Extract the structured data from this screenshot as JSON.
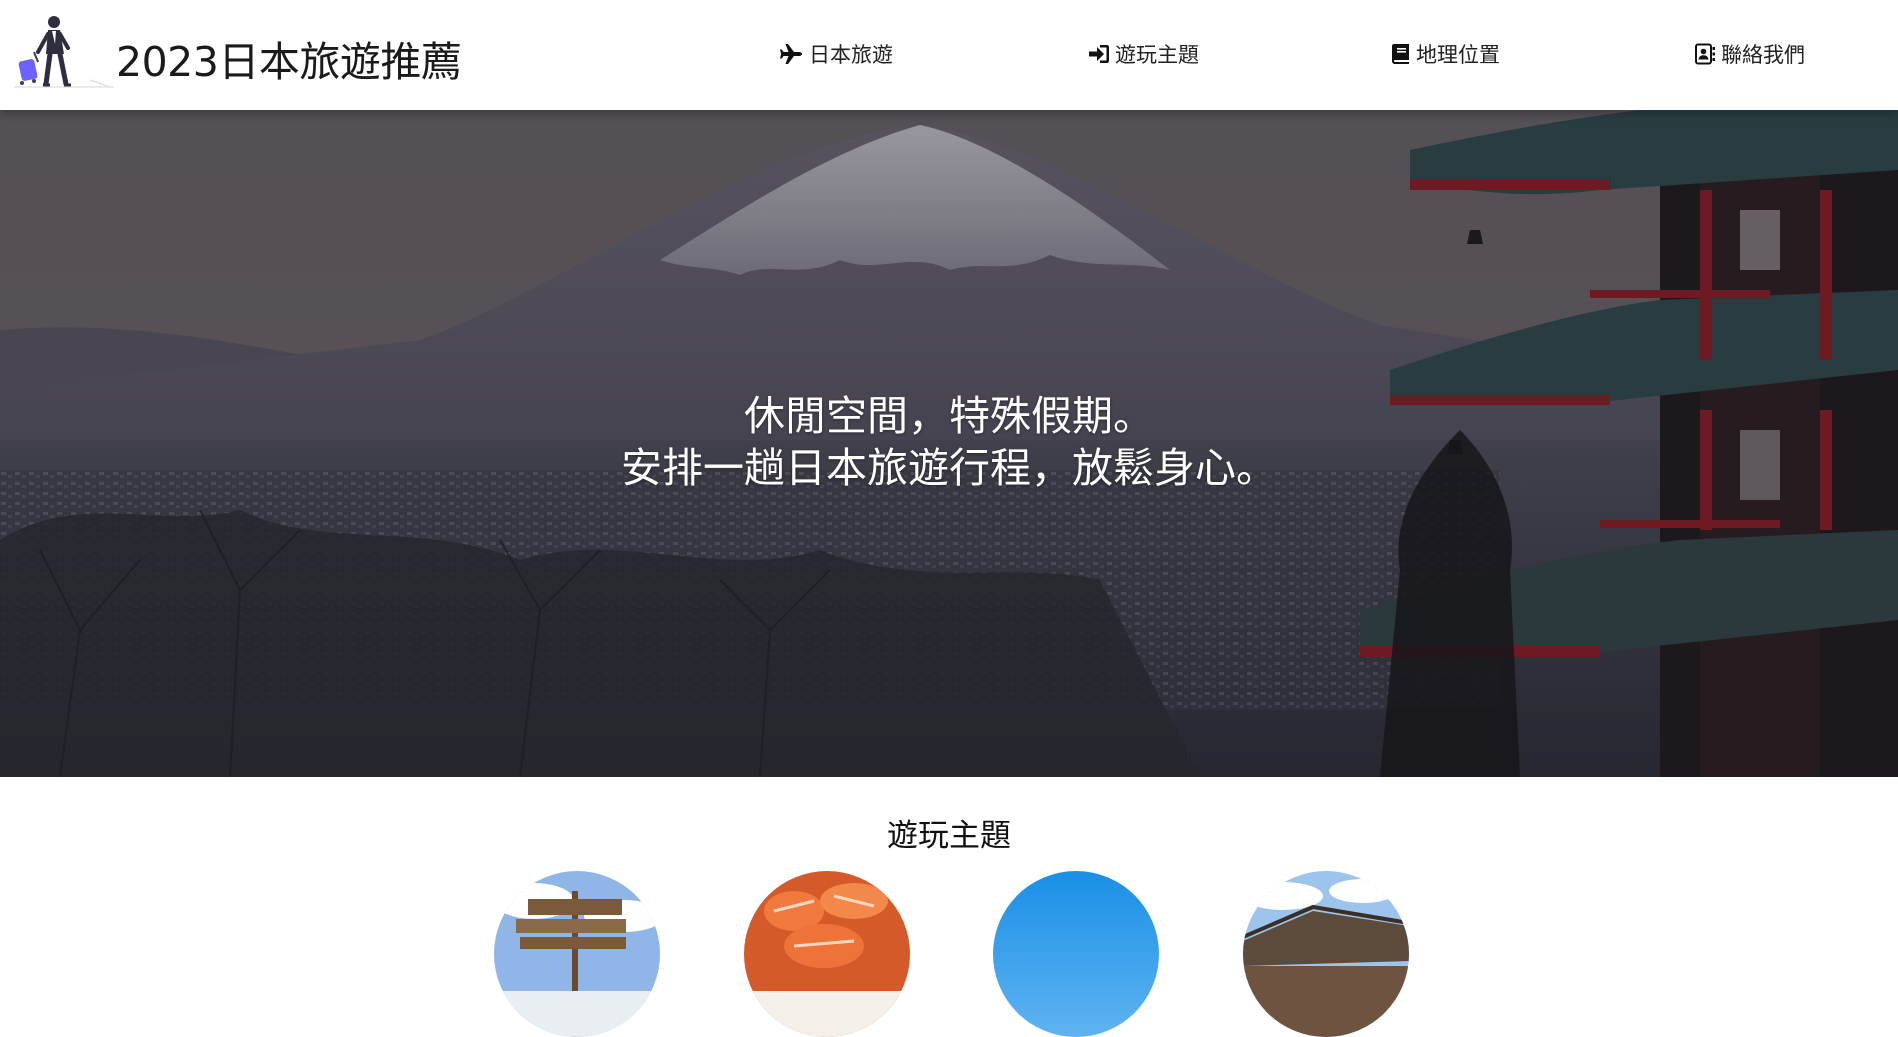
{
  "header": {
    "site_title": "2023日本旅遊推薦",
    "logo_icon": "traveler-with-suitcase-icon"
  },
  "nav": [
    {
      "label": "日本旅遊",
      "icon": "plane-icon"
    },
    {
      "label": "遊玩主題",
      "icon": "sign-in-icon"
    },
    {
      "label": "地理位置",
      "icon": "book-icon"
    },
    {
      "label": "聯絡我們",
      "icon": "address-book-icon"
    }
  ],
  "hero": {
    "line1": "休閒空間，特殊假期。",
    "line2": "安排一趟日本旅遊行程，放鬆身心。"
  },
  "themes": {
    "title": "遊玩主題",
    "items": [
      {
        "image": "sign-board-snow-scene"
      },
      {
        "image": "salmon-sushi-bowl"
      },
      {
        "image": "blue-sky"
      },
      {
        "image": "temple-roof"
      }
    ]
  },
  "colors": {
    "hero_overlay": "#2a2a32",
    "pagoda_red": "#8e1a22",
    "pagoda_roof": "#2f4a4a"
  }
}
